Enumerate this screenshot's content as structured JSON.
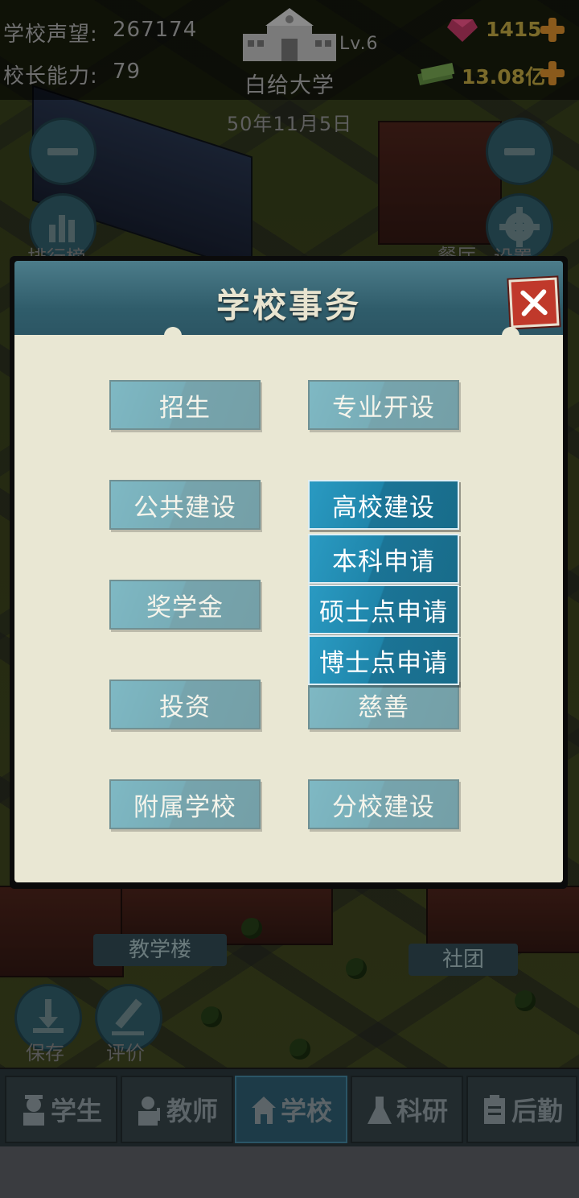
{
  "hud": {
    "reputation_label": "学校声望:",
    "reputation_value": "267174",
    "principal_label": "校长能力:",
    "principal_value": "79",
    "level": "Lv.6",
    "school_name": "白给大学",
    "date": "50年11月5日",
    "gems": "1415",
    "money": "13.08亿"
  },
  "side": {
    "ranking_label": "排行榜",
    "canteen_label": "餐厅",
    "settings_label": "设置",
    "save_label": "保存",
    "review_label": "评价"
  },
  "map_labels": {
    "teaching_building": "教学楼",
    "club": "社团"
  },
  "dialog": {
    "title": "学校事务",
    "left_buttons": [
      "招生",
      "公共建设",
      "奖学金",
      "投资",
      "附属学校"
    ],
    "right_buttons": [
      "专业开设",
      "高校建设",
      "慈善",
      "分校建设"
    ],
    "submenu": [
      "本科申请",
      "硕士点申请",
      "博士点申请"
    ]
  },
  "nav": {
    "items": [
      "学生",
      "教师",
      "学校",
      "科研",
      "后勤"
    ],
    "active": "学校"
  },
  "colors": {
    "button_blue": "#1d7fa2",
    "dialog_bg": "#e9e7d3",
    "close_red": "#c0392b"
  }
}
